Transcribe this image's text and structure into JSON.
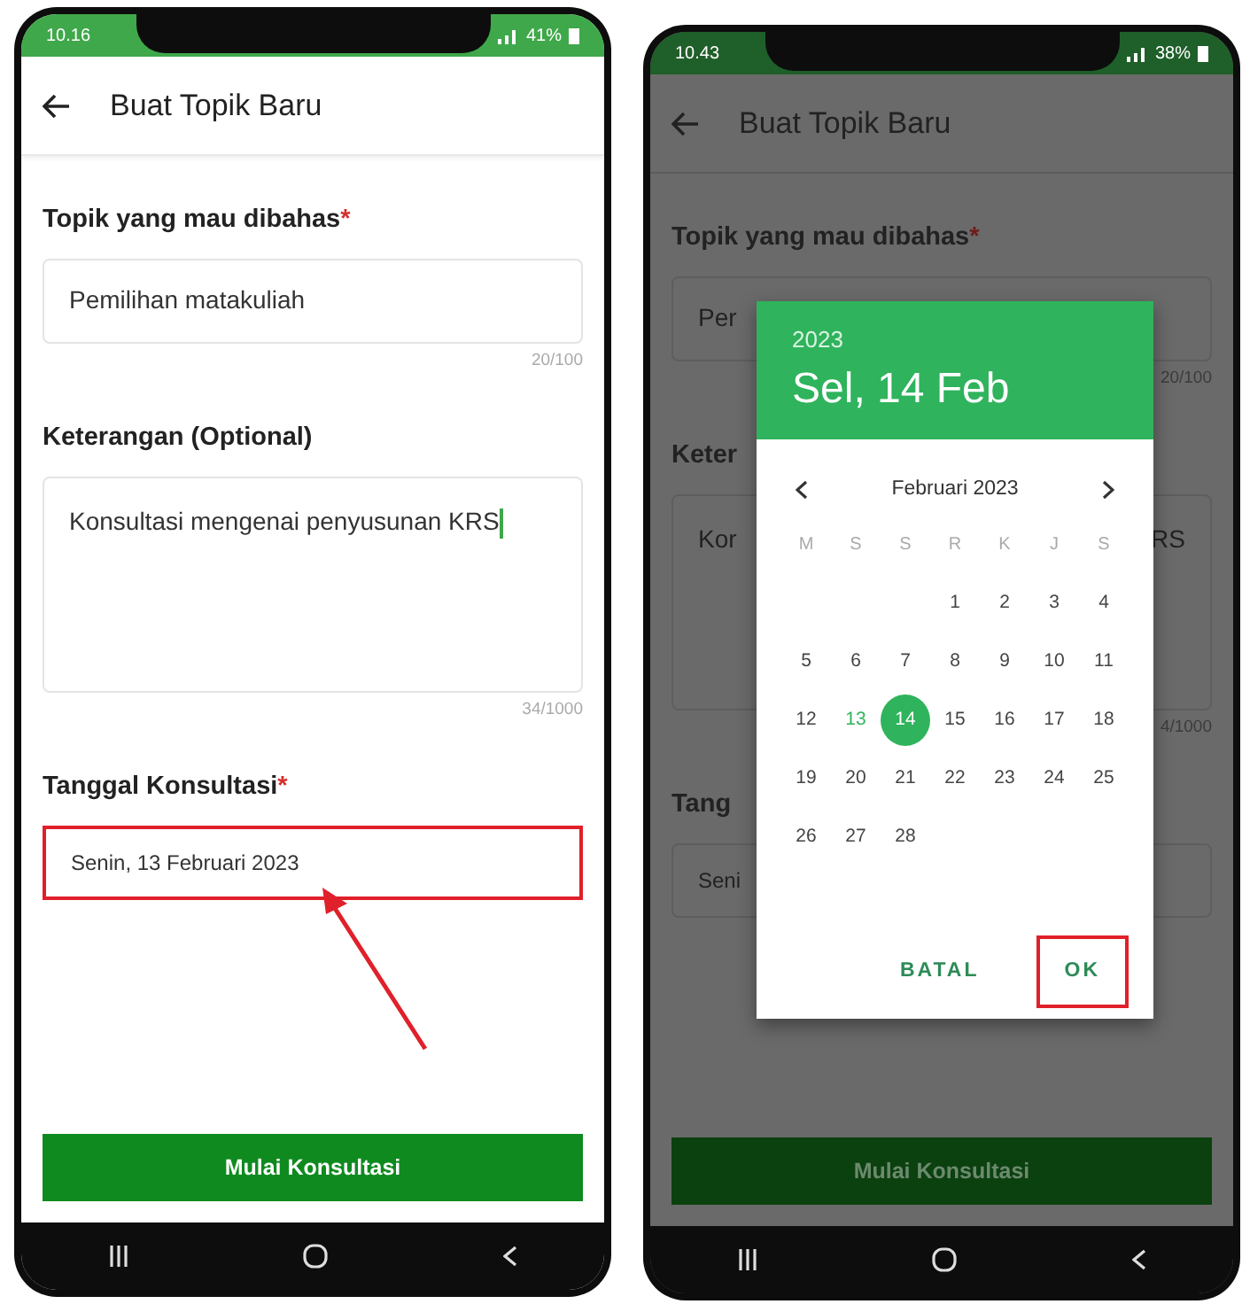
{
  "screens": [
    {
      "dimmed": false,
      "status_bar": {
        "time": "10.16",
        "battery": "41%"
      },
      "app_bar": {
        "title": "Buat Topik Baru"
      },
      "fields": [
        {
          "kind": "input",
          "label": "Topik yang mau dibahas",
          "required_mark": "*",
          "value": "Pemilihan matakuliah",
          "counter": "20/100",
          "highlighted": false
        },
        {
          "kind": "textarea",
          "label": "Keterangan (Optional)",
          "value": "Konsultasi mengenai penyusunan KRS",
          "counter": "34/1000",
          "highlighted": false,
          "focused": true
        },
        {
          "kind": "date",
          "label": "Tanggal Konsultasi",
          "required_mark": "*",
          "value": "Senin, 13 Februari 2023",
          "highlighted": true
        }
      ],
      "button": {
        "label": "Mulai Konsultasi"
      },
      "annotation_arrow": true
    },
    {
      "dimmed": true,
      "status_bar": {
        "time": "10.43",
        "battery": "38%"
      },
      "app_bar": {
        "title": "Buat Topik Baru"
      },
      "fields": [
        {
          "kind": "input",
          "label": "Topik yang mau dibahas",
          "required_mark": "*",
          "value": "Per",
          "counter": "20/100",
          "highlighted": false
        },
        {
          "kind": "textarea",
          "label": "Keter",
          "value": "Kor",
          "value_end": "RS",
          "counter": "4/1000",
          "highlighted": false
        },
        {
          "kind": "date",
          "label": "Tang",
          "value": "Seni",
          "highlighted": false
        }
      ],
      "button": {
        "label": "Mulai Konsultasi"
      },
      "dialog": {
        "year": "2023",
        "date": "Sel, 14 Feb",
        "month": "Februari 2023",
        "weekdays": [
          "M",
          "S",
          "S",
          "R",
          "K",
          "J",
          "S"
        ],
        "weeks": [
          [
            {
              "label": "1",
              "selected": false,
              "today": false
            },
            {
              "label": "2",
              "selected": false,
              "today": false
            },
            {
              "label": "3",
              "selected": false,
              "today": false
            },
            {
              "label": "4",
              "selected": false,
              "today": false
            }
          ],
          [
            {
              "label": "5",
              "selected": false,
              "today": false
            },
            {
              "label": "6",
              "selected": false,
              "today": false
            },
            {
              "label": "7",
              "selected": false,
              "today": false
            },
            {
              "label": "8",
              "selected": false,
              "today": false
            },
            {
              "label": "9",
              "selected": false,
              "today": false
            },
            {
              "label": "10",
              "selected": false,
              "today": false
            },
            {
              "label": "11",
              "selected": false,
              "today": false
            }
          ],
          [
            {
              "label": "12",
              "selected": false,
              "today": false
            },
            {
              "label": "13",
              "selected": false,
              "today": true
            },
            {
              "label": "14",
              "selected": true,
              "today": false
            },
            {
              "label": "15",
              "selected": false,
              "today": false
            },
            {
              "label": "16",
              "selected": false,
              "today": false
            },
            {
              "label": "17",
              "selected": false,
              "today": false
            },
            {
              "label": "18",
              "selected": false,
              "today": false
            }
          ],
          [
            {
              "label": "19",
              "selected": false,
              "today": false
            },
            {
              "label": "20",
              "selected": false,
              "today": false
            },
            {
              "label": "21",
              "selected": false,
              "today": false
            },
            {
              "label": "22",
              "selected": false,
              "today": false
            },
            {
              "label": "23",
              "selected": false,
              "today": false
            },
            {
              "label": "24",
              "selected": false,
              "today": false
            },
            {
              "label": "25",
              "selected": false,
              "today": false
            }
          ],
          [
            {
              "label": "26",
              "selected": false,
              "today": false
            },
            {
              "label": "27",
              "selected": false,
              "today": false
            },
            {
              "label": "28",
              "selected": false,
              "today": false
            }
          ]
        ],
        "buttons": [
          {
            "label": "BATAL",
            "highlighted": false
          },
          {
            "label": "OK",
            "highlighted": true
          }
        ]
      }
    }
  ]
}
